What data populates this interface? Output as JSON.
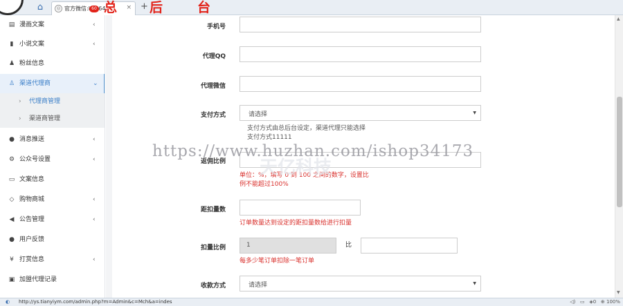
{
  "browser": {
    "tab_title": "官方微信:liu464",
    "tab_title_tail": "60",
    "new_tab_symbol": "+",
    "close_symbol": "×",
    "overlay_chars": [
      "总",
      "后",
      "台"
    ],
    "status_url": "http://ys.tianyiym.com/admin.php?m=Admin&c=Mch&a=indes",
    "zoom": "100%",
    "tray_counter": "0"
  },
  "sidebar": {
    "items": [
      {
        "icon": "document-icon",
        "label": "漫画文案",
        "has_arrow": true
      },
      {
        "icon": "book-icon",
        "label": "小说文案",
        "has_arrow": true
      },
      {
        "icon": "users-icon",
        "label": "粉丝信息",
        "has_arrow": false
      },
      {
        "icon": "user-plus-icon",
        "label": "渠道代理商",
        "expanded": true
      },
      {
        "icon": "chat-bubble-icon",
        "label": "消息推送",
        "has_arrow": true
      },
      {
        "icon": "gears-icon",
        "label": "公众号设置",
        "has_arrow": true
      },
      {
        "icon": "id-card-icon",
        "label": "文案信息",
        "has_arrow": false
      },
      {
        "icon": "diamond-icon",
        "label": "购物商城",
        "has_arrow": true
      },
      {
        "icon": "bullhorn-icon",
        "label": "公告管理",
        "has_arrow": true
      },
      {
        "icon": "comment-icon",
        "label": "用户反馈",
        "has_arrow": false
      },
      {
        "icon": "yen-icon",
        "label": "打赏信息",
        "has_arrow": true
      },
      {
        "icon": "list-card-icon",
        "label": "加盟代理记录",
        "has_arrow": false
      }
    ],
    "submenu": [
      {
        "label": "代理商管理",
        "active": true
      },
      {
        "label": "渠道商管理",
        "active": false
      }
    ]
  },
  "form": {
    "phone_label": "手机号",
    "qq_label": "代理QQ",
    "wechat_label": "代理微信",
    "payment_label": "支付方式",
    "payment_value": "请选择",
    "payment_hint_1": "支付方式由总后台设定，渠道代理只能选择",
    "payment_hint_2": "支付方式11111",
    "ratio_label": "返佣比例",
    "ratio_error_1": "单位：%，填写 0 到 100 之间的数字，设置比",
    "ratio_error_2": "例不能超过100%",
    "deduct_gap_label": "距扣量数",
    "deduct_gap_error": "订单数量达到设定的距扣量数给进行扣量",
    "deduct_ratio_label": "扣量比例",
    "deduct_ratio_value": "1",
    "deduct_ratio_sep": "比",
    "deduct_ratio_error": "每多少笔订单扣除一笔订单",
    "receive_label": "收款方式",
    "receive_value": "请选择"
  },
  "watermark": {
    "url_text": "https://www.huzhan.com/ishop34173",
    "logo_text": "天亿科技"
  }
}
